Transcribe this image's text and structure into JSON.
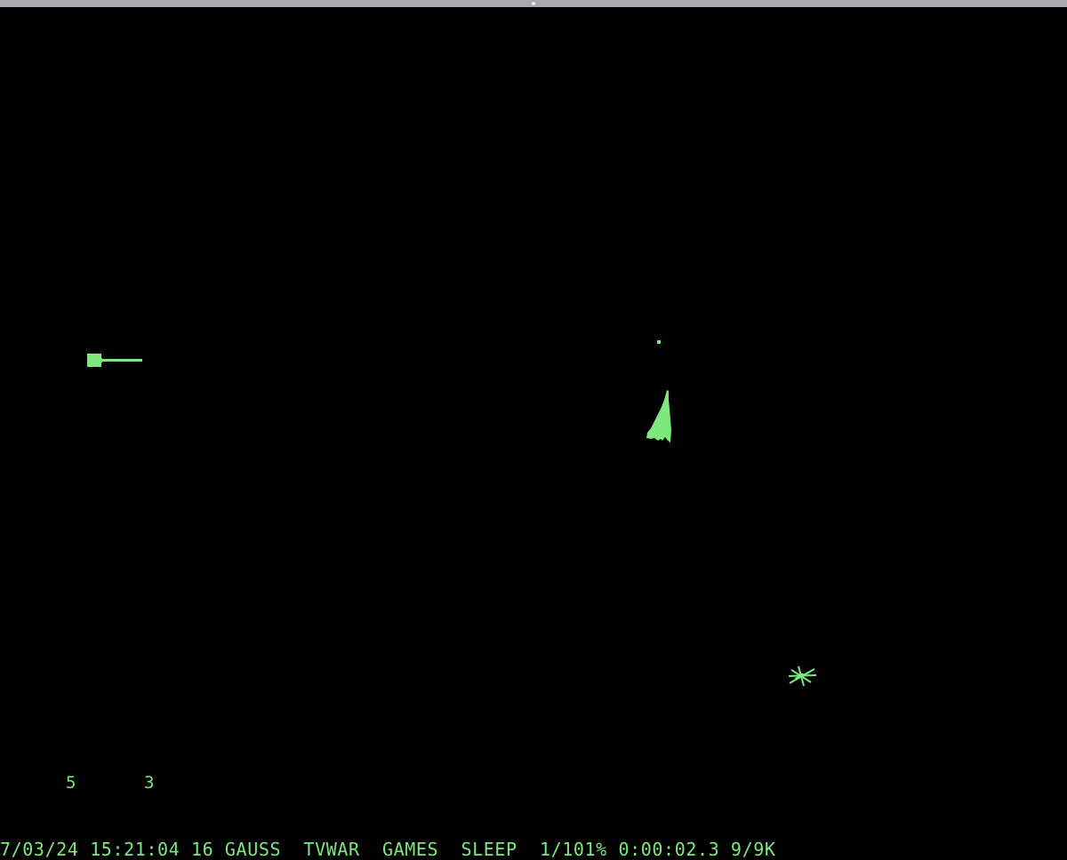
{
  "game": {
    "phosphor_color": "#7ee87e",
    "background_color": "#000000",
    "scores": {
      "player_left": "5",
      "player_right": "3"
    },
    "objects": [
      {
        "id": "ship-wedge",
        "icon": "wedge-ship-icon"
      },
      {
        "id": "ship-needle",
        "icon": "needle-ship-icon"
      },
      {
        "id": "torpedo",
        "icon": "torpedo-dot"
      },
      {
        "id": "sun",
        "icon": "sun-star-icon"
      }
    ]
  },
  "status_bar": {
    "date": "7/03/24",
    "time": "15:21:04",
    "users": "16",
    "user": "GAUSS",
    "job": "TVWAR",
    "directory": "GAMES",
    "state": "SLEEP",
    "load": "1/101%",
    "runtime": "0:00:02.3",
    "memory": "9/9K"
  }
}
